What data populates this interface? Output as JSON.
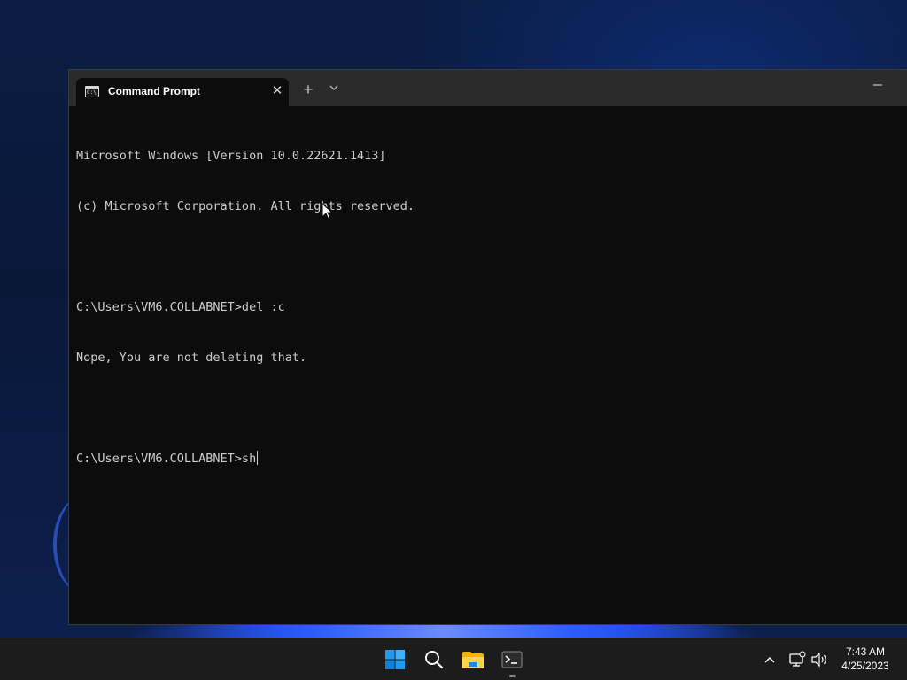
{
  "window": {
    "tab_title": "Command Prompt",
    "tab_icon_text": "C:\\",
    "close_glyph": "✕",
    "new_tab_glyph": "+",
    "dropdown_glyph": "⌄",
    "minimize_glyph": "—"
  },
  "console": {
    "lines": [
      "Microsoft Windows [Version 10.0.22621.1413]",
      "(c) Microsoft Corporation. All rights reserved.",
      "",
      "C:\\Users\\VM6.COLLABNET>del :c",
      "Nope, You are not deleting that.",
      "",
      "C:\\Users\\VM6.COLLABNET>sh"
    ]
  },
  "taskbar": {
    "items": [
      "start-icon",
      "search-icon",
      "file-explorer-icon",
      "terminal-icon"
    ],
    "time": "7:43 AM",
    "date": "4/25/2023"
  },
  "colors": {
    "console_bg": "#0c0c0c",
    "console_text": "#cccccc",
    "titlebar": "#2b2b2b",
    "taskbar": "#1c1c1c",
    "start_blue": "#1e9bf0"
  }
}
